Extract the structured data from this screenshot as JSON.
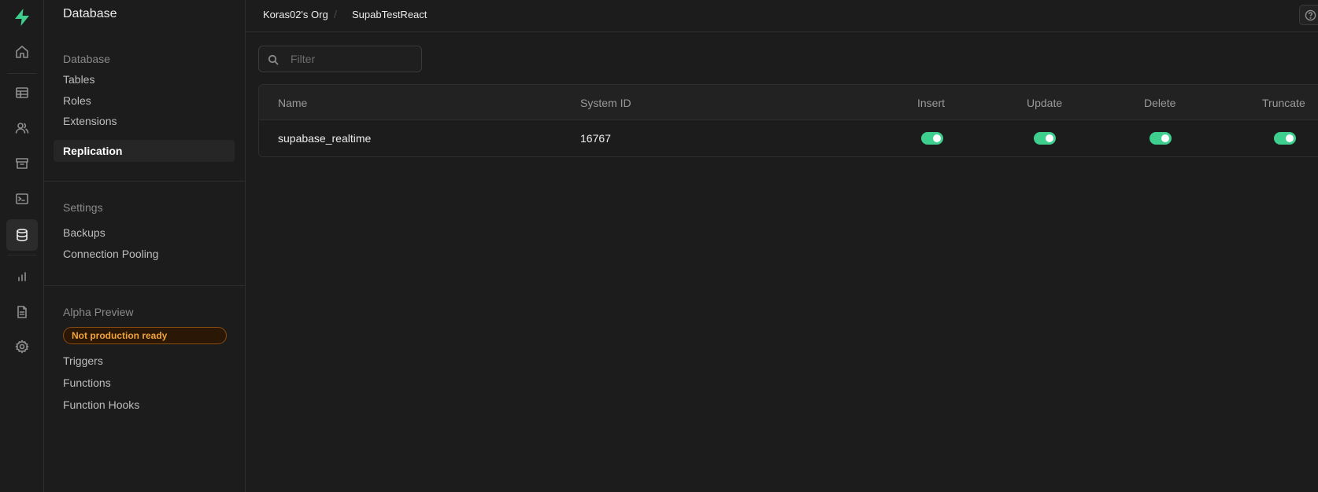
{
  "sidebar": {
    "title": "Database",
    "groups": [
      {
        "heading": "Database",
        "items": [
          "Tables",
          "Roles",
          "Extensions",
          "Replication"
        ]
      },
      {
        "heading": "Settings",
        "items": [
          "Backups",
          "Connection Pooling"
        ]
      },
      {
        "heading": "Alpha Preview",
        "badge": "Not production ready",
        "items": [
          "Triggers",
          "Functions",
          "Function Hooks"
        ]
      }
    ],
    "active_item": "Replication"
  },
  "rail": {
    "icons": [
      "supabase-logo",
      "home-icon",
      "table-icon",
      "users-icon",
      "archive-icon",
      "terminal-icon",
      "database-icon",
      "chart-icon",
      "document-icon",
      "gear-icon"
    ],
    "active": "database-icon"
  },
  "breadcrumb": {
    "org": "Koras02's Org",
    "separator": "/",
    "project": "SupabTestReact"
  },
  "filter": {
    "placeholder": "Filter",
    "value": ""
  },
  "table": {
    "columns": [
      "Name",
      "System ID",
      "Insert",
      "Update",
      "Delete",
      "Truncate"
    ],
    "rows": [
      {
        "name": "supabase_realtime",
        "system_id": "16767",
        "insert": true,
        "update": true,
        "delete": true,
        "truncate": true
      }
    ]
  },
  "colors": {
    "accent": "#3ecf8e",
    "warning": "#f0a43a"
  }
}
